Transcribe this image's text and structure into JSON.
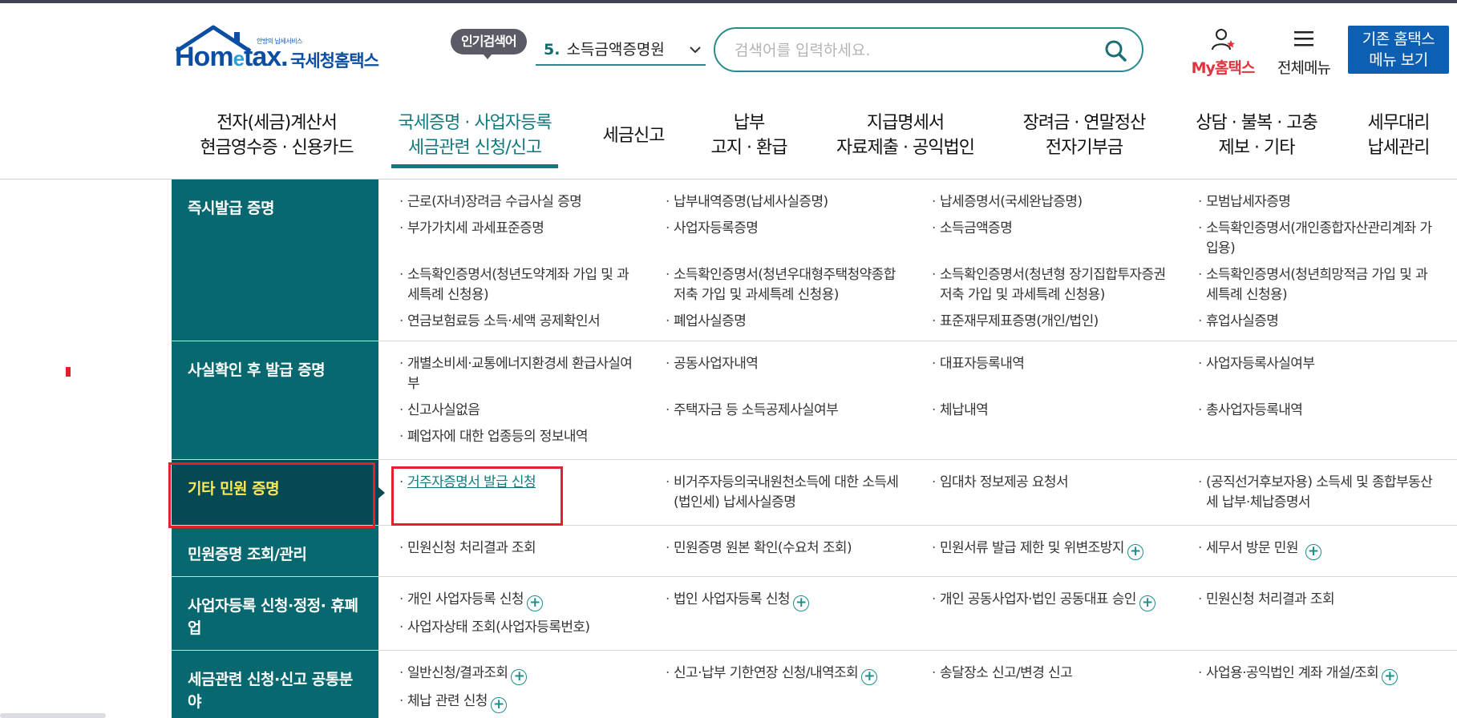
{
  "header": {
    "logo": {
      "tagline": "안방의 납세서비스",
      "wordmark_pre": "Hom",
      "wordmark_e": "e",
      "wordmark_post": "tax.",
      "name_kor": "국세청홈택스"
    },
    "popular": {
      "badge": "인기검색어",
      "rank": "5.",
      "term": "소득금액증명원",
      "chevron": "chevron-down-icon"
    },
    "search": {
      "placeholder": "검색어를 입력하세요.",
      "icon": "search-icon"
    },
    "my_hometax": {
      "label": "My홈택스",
      "icon": "user-star-icon"
    },
    "all_menu": {
      "label": "전체메뉴",
      "icon": "hamburger-icon"
    },
    "old_home": {
      "line1": "기존 홈택스",
      "line2": "메뉴 보기"
    }
  },
  "gnb": [
    {
      "line1": "전자(세금)계산서",
      "line2": "현금영수증 · 신용카드"
    },
    {
      "line1": "국세증명 · 사업자등록",
      "line2": "세금관련 신청/신고",
      "active": true
    },
    {
      "line1": "세금신고",
      "line2": ""
    },
    {
      "line1": "납부",
      "line2": "고지 · 환급"
    },
    {
      "line1": "지급명세서",
      "line2": "자료제출 · 공익법인"
    },
    {
      "line1": "장려금 · 연말정산",
      "line2": "전자기부금"
    },
    {
      "line1": "상담 · 불복 · 고충",
      "line2": "제보 · 기타"
    },
    {
      "line1": "세무대리",
      "line2": "납세관리"
    }
  ],
  "menu": [
    {
      "category": "즉시발급 증명",
      "links": [
        "근로(자녀)장려금 수급사실 증명",
        "납부내역증명(납세사실증명)",
        "납세증명서(국세완납증명)",
        "모범납세자증명",
        "부가가치세 과세표준증명",
        "사업자등록증명",
        "소득금액증명",
        "소득확인증명서(개인종합자산관리계좌 가입용)",
        "소득확인증명서(청년도약계좌 가입 및 과세특례 신청용)",
        "소득확인증명서(청년우대형주택청약종합저축 가입 및 과세특례 신청용)",
        "소득확인증명서(청년형 장기집합투자증권저축 가입 및 과세특례 신청용)",
        "소득확인증명서(청년희망적금 가입 및 과세특례 신청용)",
        "연금보험료등 소득·세액 공제확인서",
        "폐업사실증명",
        "표준재무제표증명(개인/법인)",
        "휴업사실증명"
      ]
    },
    {
      "category": "사실확인 후 발급 증명",
      "links": [
        "개별소비세·교통에너지환경세 환급사실여부",
        "공동사업자내역",
        "대표자등록내역",
        "사업자등록사실여부",
        "신고사실없음",
        "주택자금 등 소득공제사실여부",
        "체납내역",
        "총사업자등록내역",
        "폐업자에 대한 업종등의 정보내역"
      ]
    },
    {
      "category": "기타 민원 증명",
      "selected": true,
      "links": [
        "거주자증명서 발급 신청",
        "비거주자등의국내원천소득에 대한 소득세(법인세) 납세사실증명",
        "임대차 정보제공 요청서",
        "(공직선거후보자용) 소득세 및 종합부동산세 납부·체납증명서"
      ]
    },
    {
      "category": "민원증명 조회/관리",
      "links": [
        "민원신청 처리결과 조회",
        "민원증명 원본 확인(수요처 조회)",
        "민원서류 발급 제한 및 위변조방지",
        "세무서 방문 민원"
      ]
    },
    {
      "category": "사업자등록 신청·정정· 휴폐업",
      "links": [
        "개인 사업자등록 신청",
        "법인 사업자등록 신청",
        "개인 공동사업자·법인 공동대표 승인",
        "민원신청 처리결과 조회",
        "사업자상태 조회(사업자등록번호)"
      ]
    },
    {
      "category": "세금관련 신청·신고 공통분야",
      "links": [
        "일반신청/결과조회",
        "신고·납부 기한연장 신청/내역조회",
        "송달장소 신고/변경 신고",
        "사업용·공익법인 계좌 개설/조회",
        "체납 관련 신청"
      ]
    }
  ],
  "colors": {
    "teal": "#076870",
    "teal_dark": "#054a52",
    "highlight_yellow": "#ffe85a",
    "red_annotation": "#e0222b",
    "accent_red": "#e0323f"
  }
}
